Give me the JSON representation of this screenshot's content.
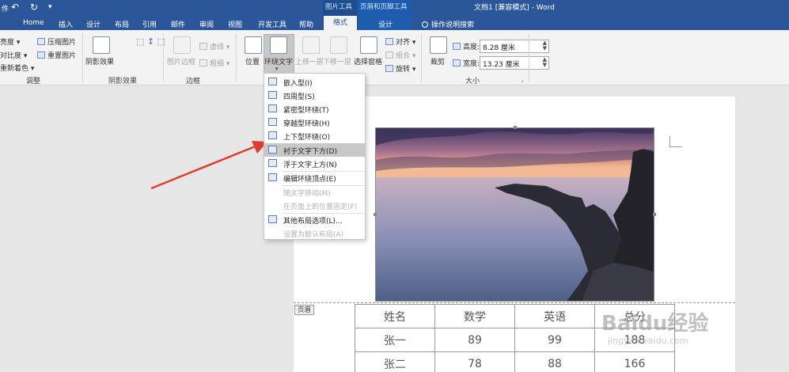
{
  "titlebar": {
    "doc_title": "文档1 [兼容模式] - Word",
    "context_picture_tools": "图片工具",
    "context_header_tools": "页眉和页脚工具",
    "quick_access": [
      "件",
      "↶",
      "↻",
      "▾"
    ]
  },
  "tabs": [
    "Home",
    "插入",
    "设计",
    "布局",
    "引用",
    "邮件",
    "审阅",
    "视图",
    "开发工具",
    "帮助",
    "格式",
    "设计"
  ],
  "active_tab": "格式",
  "tell_me": "操作说明搜索",
  "ribbon": {
    "adjust": {
      "items": [
        "亮度 ▾",
        "对比度 ▾",
        "重新着色 ▾"
      ],
      "compress": "压缩图片",
      "reset": "重置图片",
      "label": "调整"
    },
    "shadow": {
      "button": "阴影效果",
      "label": "阴影效果"
    },
    "border": {
      "button": "图片边框",
      "line_style": "虚线 ▾",
      "line_weight": "粗细 ▾",
      "label": "边框"
    },
    "arrange": {
      "position": "位置",
      "wrap_text": "环绕文字",
      "bring_forward": "上移一层",
      "send_backward": "下移一层",
      "selection_pane": "选择窗格",
      "align": "对齐 ▾",
      "group": "组合 ▾",
      "rotate": "旋转 ▾"
    },
    "size": {
      "crop": "裁剪",
      "height_label": "高度:",
      "height_value": "8.28 厘米",
      "width_label": "宽度:",
      "width_value": "13.23 厘米",
      "label": "大小"
    }
  },
  "wrap_menu": [
    {
      "label": "嵌入型(I)",
      "enabled": true
    },
    {
      "label": "四周型(S)",
      "enabled": true
    },
    {
      "label": "紧密型环绕(T)",
      "enabled": true
    },
    {
      "label": "穿越型环绕(H)",
      "enabled": true
    },
    {
      "label": "上下型环绕(O)",
      "enabled": true
    },
    {
      "label": "衬于文字下方(D)",
      "enabled": true,
      "highlighted": true
    },
    {
      "label": "浮于文字上方(N)",
      "enabled": true
    },
    {
      "label": "编辑环绕顶点(E)",
      "enabled": true
    },
    {
      "label": "随文字移动(M)",
      "enabled": false
    },
    {
      "label": "在页面上的位置固定(F)",
      "enabled": false
    },
    {
      "label": "其他布局选项(L)...",
      "enabled": true
    },
    {
      "label": "设置为默认布局(A)",
      "enabled": false
    }
  ],
  "document": {
    "header_tag": "页眉",
    "table": {
      "headers": [
        "姓名",
        "数学",
        "英语",
        "总分"
      ],
      "rows": [
        [
          "张一",
          "89",
          "99",
          "188"
        ],
        [
          "张二",
          "78",
          "88",
          "166"
        ]
      ]
    }
  },
  "watermark": {
    "logo": "Baidu经验",
    "url": "jingyan.baidu.com"
  },
  "colors": {
    "title_bar": "#2b579a",
    "ribbon": "#f3f3f3",
    "arrow": "#e03c2a",
    "highlight": "#c8c8c8"
  }
}
